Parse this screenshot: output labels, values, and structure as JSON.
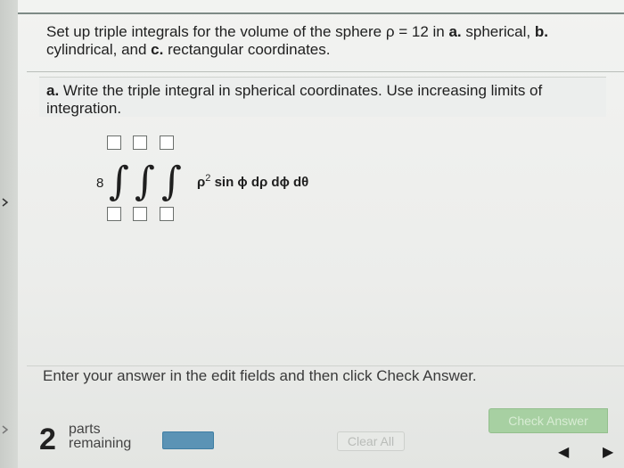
{
  "question": {
    "text_parts": [
      {
        "t": "Set up triple integrals for the volume of the sphere ρ = 12 in "
      },
      {
        "t": "a.",
        "b": true
      },
      {
        "t": " spherical, "
      },
      {
        "t": "b.",
        "b": true
      },
      {
        "t": " cylindrical, and "
      },
      {
        "t": "c.",
        "b": true
      },
      {
        "t": " rectangular coordinates."
      }
    ]
  },
  "subquestion": {
    "label": "a.",
    "text": "Write the triple integral in spherical coordinates. Use increasing limits of integration."
  },
  "integral": {
    "coefficient": "8",
    "integral_symbol": "∫",
    "integrand_rho": "ρ",
    "integrand_power": "2",
    "integrand_rest": " sin ϕ dρ dϕ dθ",
    "upper_limits": [
      "",
      "",
      ""
    ],
    "lower_limits": [
      "",
      "",
      ""
    ]
  },
  "footer": {
    "instruction": "Enter your answer in the edit fields and then click Check Answer.",
    "parts_count": "2",
    "parts_label_line1": "parts",
    "parts_label_line2": "remaining",
    "clear_all_label": "Clear All",
    "check_answer_label": "Check Answer",
    "progress_fraction": 1.0
  },
  "icons": {
    "left_chevrons": [
      "chevron-right-icon",
      "chevron-right-icon"
    ],
    "nav": [
      "arrow-left-icon",
      "arrow-right-icon"
    ]
  },
  "colors": {
    "check_answer_bg": "#a7d0a2",
    "progress_bar": "#5b93b5",
    "background": "#ecedeb"
  }
}
